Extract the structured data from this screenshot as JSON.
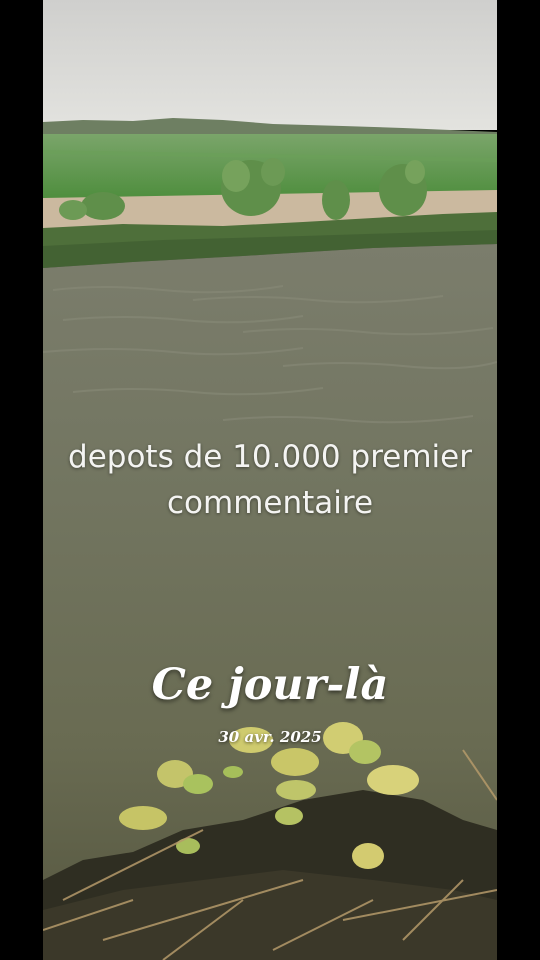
{
  "caption": {
    "line1": "depots de 10.000 premier",
    "line2": "commentaire"
  },
  "memory": {
    "title": "Ce jour-là",
    "date": "30 avr. 2025"
  },
  "colors": {
    "sky": "#d9d9d7",
    "field": "#5e9a4c",
    "water": "#6a6d55",
    "text": "#ffffff"
  }
}
